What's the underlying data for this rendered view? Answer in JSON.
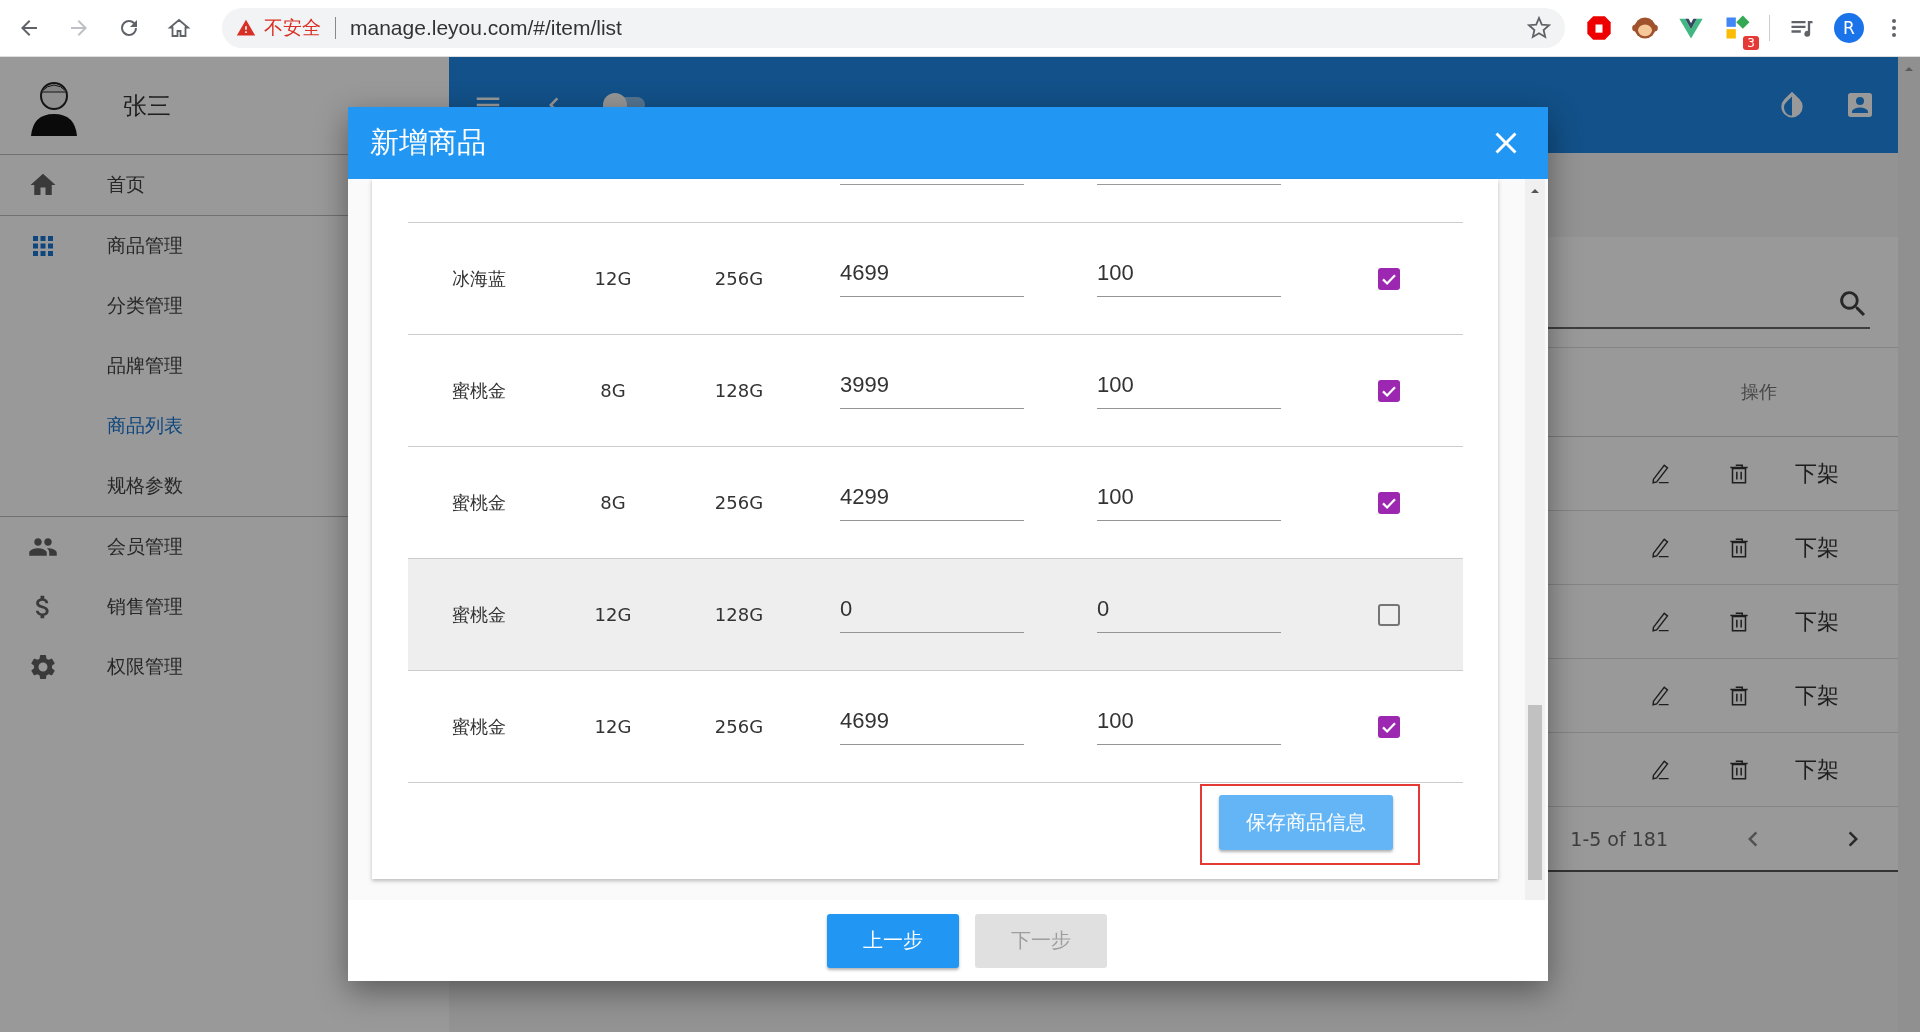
{
  "browser": {
    "security_label": "不安全",
    "url": "manage.leyou.com/#/item/list",
    "extension_badge": "3",
    "profile_initial": "R"
  },
  "sidebar": {
    "user_name": "张三",
    "items": [
      {
        "label": "首页",
        "kind": "home",
        "selected": false
      },
      {
        "label": "商品管理",
        "kind": "apps",
        "selected": false,
        "expanded": true,
        "children": [
          {
            "label": "分类管理",
            "selected": false
          },
          {
            "label": "品牌管理",
            "selected": false
          },
          {
            "label": "商品列表",
            "selected": true
          },
          {
            "label": "规格参数",
            "selected": false
          }
        ]
      },
      {
        "label": "会员管理",
        "kind": "people",
        "selected": false
      },
      {
        "label": "销售管理",
        "kind": "dollar",
        "selected": false
      },
      {
        "label": "权限管理",
        "kind": "gear",
        "selected": false
      }
    ]
  },
  "app_bar": {
    "theme_toggle": {
      "on": false
    }
  },
  "item_table": {
    "action_header": "操作",
    "rows": [
      {
        "action": "下架"
      },
      {
        "action": "下架"
      },
      {
        "action": "下架"
      },
      {
        "action": "下架"
      },
      {
        "action": "下架"
      }
    ],
    "pagination": "1-5 of 181"
  },
  "dialog": {
    "title": "新增商品",
    "sku_rows": [
      {
        "shade": "冰海蓝",
        "ram": "12G",
        "storage": "256G",
        "price": "4699",
        "stock": "100",
        "enabled": true,
        "hovered": false
      },
      {
        "shade": "蜜桃金",
        "ram": "8G",
        "storage": "128G",
        "price": "3999",
        "stock": "100",
        "enabled": true,
        "hovered": false
      },
      {
        "shade": "蜜桃金",
        "ram": "8G",
        "storage": "256G",
        "price": "4299",
        "stock": "100",
        "enabled": true,
        "hovered": false
      },
      {
        "shade": "蜜桃金",
        "ram": "12G",
        "storage": "128G",
        "price": "0",
        "stock": "0",
        "enabled": false,
        "hovered": true
      },
      {
        "shade": "蜜桃金",
        "ram": "12G",
        "storage": "256G",
        "price": "4699",
        "stock": "100",
        "enabled": true,
        "hovered": false
      }
    ],
    "save_button": {
      "label": "保存商品信息",
      "highlighted": true
    },
    "buttons": [
      {
        "label": "上一步",
        "disabled": false
      },
      {
        "label": "下一步",
        "disabled": true
      }
    ]
  }
}
